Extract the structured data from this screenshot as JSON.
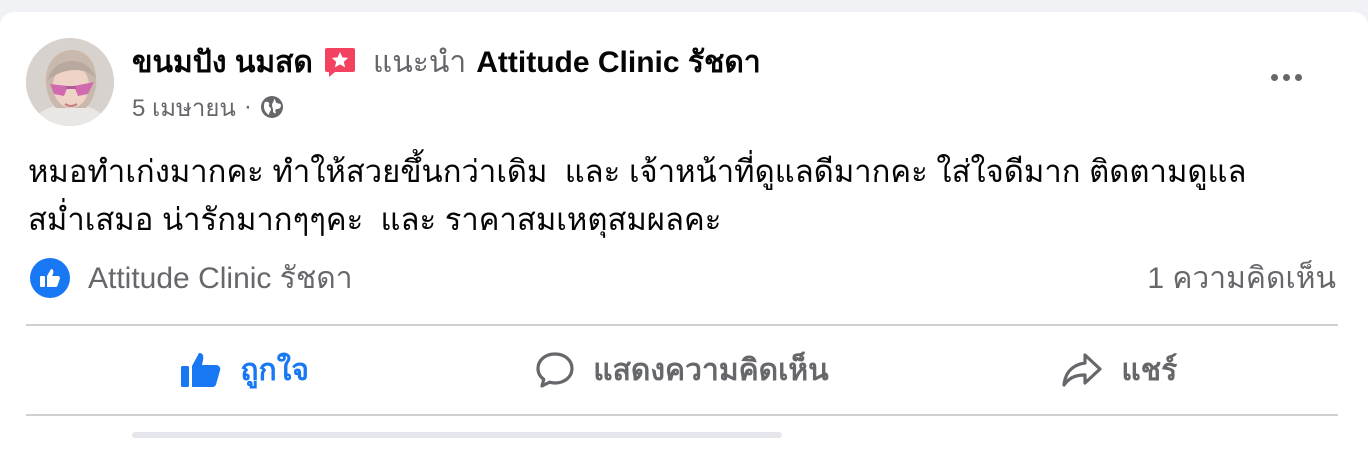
{
  "post": {
    "author": "ขนมปัง นมสด",
    "recommend_icon": "recommend-star-icon",
    "recommends_label": "แนะนำ",
    "page_name": "Attitude Clinic รัชดา",
    "date": "5 เมษายน",
    "separator": "·",
    "privacy_icon": "globe-icon",
    "more_icon": "more-options-icon",
    "text_lines": [
      "หมอทำเก่งมากคะ ทำให้สวยขึ้นกว่าเดิม  และ เจ้าหน้าที่ดูแลดีมากคะ ใส่ใจดีมาก ติดตามดูแล",
      "สม่ำเสมอ น่ารักมากๆๆคะ  และ ราคาสมเหตุสมผลคะ"
    ]
  },
  "reactions": {
    "icon": "like-reaction-icon",
    "names": "Attitude Clinic รัชดา",
    "comment_count": "1 ความคิดเห็น"
  },
  "actions": {
    "like_label": "ถูกใจ",
    "comment_label": "แสดงความคิดเห็น",
    "share_label": "แชร์"
  },
  "colors": {
    "accent": "#1877f2",
    "secondary_text": "#65676b",
    "recommend": "#f3425f"
  }
}
